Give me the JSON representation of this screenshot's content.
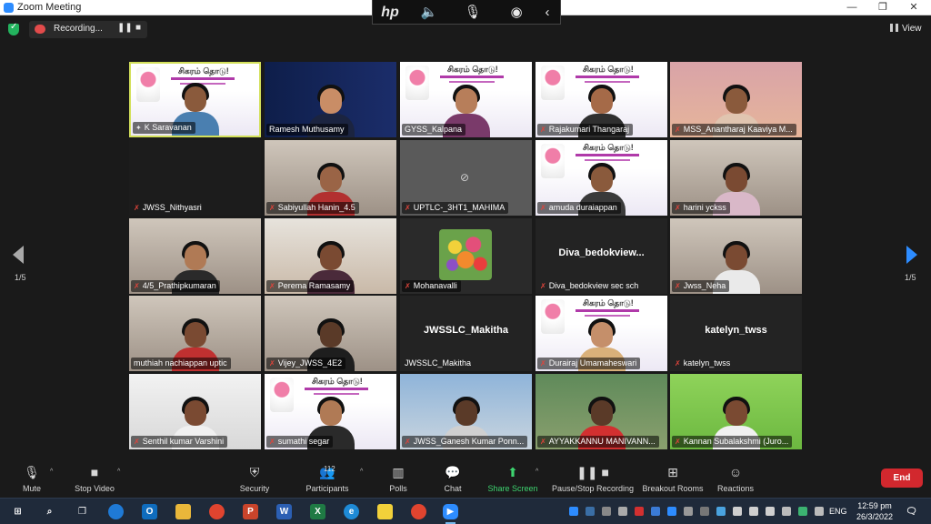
{
  "window": {
    "title": "Zoom Meeting"
  },
  "hp_toolbar": {
    "logo": "hp"
  },
  "recording": {
    "label": "Recording..."
  },
  "view": {
    "label": "View"
  },
  "pagination": {
    "left": "1/5",
    "right": "1/5"
  },
  "tiles": [
    {
      "name": "K Saravanan",
      "kind": "banner-person",
      "skin": "#8a5a3c",
      "shirt": "#4a7fb0",
      "active": true,
      "muted": false
    },
    {
      "name": "Ramesh Muthusamy",
      "kind": "blue-person",
      "skin": "#c98d66",
      "shirt": "#1b2440",
      "muted": false
    },
    {
      "name": "GYSS_Kalpana",
      "kind": "banner-person",
      "skin": "#b77e5a",
      "shirt": "#7a3a6a",
      "muted": false
    },
    {
      "name": "Rajakumari Thangaraj",
      "kind": "banner-person",
      "skin": "#a56a48",
      "shirt": "#2f2f2f",
      "muted": true
    },
    {
      "name": "MSS_Anantharaj Kaaviya M...",
      "kind": "warm-person",
      "skin": "#8a5a3c",
      "shirt": "#e0c5b0",
      "muted": true
    },
    {
      "name": "JWSS_Nithyasri",
      "kind": "dark",
      "muted": true
    },
    {
      "name": "Sabiyullah Hanin_4.5",
      "kind": "room-person",
      "skin": "#9a6446",
      "shirt": "#b23030",
      "muted": true
    },
    {
      "name": "UPTLC-_3HT1_MAHIMA",
      "kind": "video-off",
      "muted": true
    },
    {
      "name": "amuda duraiappan",
      "kind": "banner-person",
      "skin": "#8a5a3c",
      "shirt": "#3a3a3a",
      "muted": true
    },
    {
      "name": "harini yckss",
      "kind": "room-person",
      "skin": "#7a4a32",
      "shirt": "#d9b8c8",
      "muted": true
    },
    {
      "name": "4/5_Prathipkumaran",
      "kind": "room-person",
      "skin": "#b07a55",
      "shirt": "#2a2a2a",
      "muted": true
    },
    {
      "name": "Perema Ramasamy",
      "kind": "school-person",
      "skin": "#7a4a32",
      "shirt": "#4a2a3a",
      "muted": true
    },
    {
      "name": "Mohanavalli",
      "kind": "flowers",
      "muted": true
    },
    {
      "name": "Diva_bedokview sec sch",
      "kind": "name-only",
      "center": "Diva_bedokview...",
      "muted": true
    },
    {
      "name": "Jwss_Neha",
      "kind": "room-person",
      "skin": "#7a4a32",
      "shirt": "#eaeaea",
      "muted": true
    },
    {
      "name": "muthiah nachiappan uptic",
      "kind": "room-person",
      "skin": "#7a4a32",
      "shirt": "#c03030",
      "muted": false
    },
    {
      "name": "Vijey_JWSS_4E2",
      "kind": "room-person",
      "skin": "#5a3a28",
      "shirt": "#1e1e1e",
      "muted": true
    },
    {
      "name": "JWSSLC_Makitha",
      "kind": "name-only",
      "center": "JWSSLC_Makitha",
      "muted": false
    },
    {
      "name": "Durairaj Umamaheswari",
      "kind": "banner-person",
      "skin": "#c58f6a",
      "shirt": "#d9b07a",
      "muted": true
    },
    {
      "name": "katelyn_twss",
      "kind": "name-only",
      "center": "katelyn_twss",
      "muted": true
    },
    {
      "name": "Senthil kumar Varshini",
      "kind": "white-room",
      "skin": "#7a4a32",
      "shirt": "#f0f0f0",
      "muted": true
    },
    {
      "name": "sumathi segar",
      "kind": "banner-person",
      "skin": "#b07a55",
      "shirt": "#2a2a2a",
      "muted": true
    },
    {
      "name": "JWSS_Ganesh Kumar Ponn...",
      "kind": "campus-person",
      "skin": "#5a3a28",
      "shirt": "#d0d0d0",
      "muted": true
    },
    {
      "name": "AYYAKKANNU MANIVANN...",
      "kind": "fan-person",
      "skin": "#5a3a28",
      "shirt": "#d23030",
      "muted": true
    },
    {
      "name": "Kannan Subalakshmi (Juro...",
      "kind": "green-person",
      "skin": "#7a4a32",
      "shirt": "#f0f0f0",
      "muted": true
    }
  ],
  "banner": {
    "title": "சிகரம் தொடு!"
  },
  "toolbar": {
    "mute": "Mute",
    "stop_video": "Stop Video",
    "security": "Security",
    "participants": "Participants",
    "participant_count": "112",
    "polls": "Polls",
    "chat": "Chat",
    "share_screen": "Share Screen",
    "pause_recording": "Pause/Stop Recording",
    "breakout_rooms": "Breakout Rooms",
    "reactions": "Reactions",
    "end": "End"
  },
  "taskbar": {
    "lang": "ENG",
    "time": "12:59 pm",
    "date": "26/3/2022"
  },
  "colors": {
    "zoom_blue": "#2d8cff",
    "active_speaker": "#d3e05a",
    "end_red": "#d2282e",
    "share_green": "#3dd36f"
  }
}
